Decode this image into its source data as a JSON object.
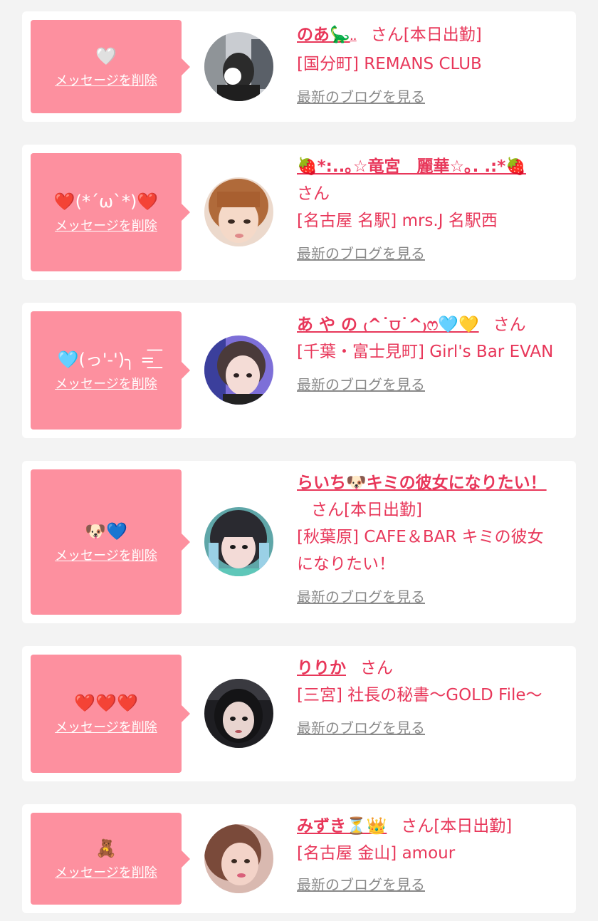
{
  "delete_label": "メッセージを削除",
  "blog_label": "最新のブログを見る",
  "colors": {
    "background": "#f3f3f3",
    "card": "#ffffff",
    "message_box": "#fd909f",
    "accent_text": "#e8375a",
    "link_gray": "#8a8a8a"
  },
  "favorites": [
    {
      "message": "🤍",
      "name": "のあ🦕",
      "name_suffix": "..",
      "suffix": "さん[本日出勤]",
      "shop": "[国分町] REMANS CLUB",
      "avatar_icon": "girl-photo-avatar-icon"
    },
    {
      "message": "❤️(*´ω`*)❤️",
      "name": "🍓*:..｡☆竜宮　麗華☆｡. .:*🍓",
      "name_suffix": "",
      "suffix": "さん",
      "shop": "[名古屋 名駅] mrs.J 名駅西",
      "avatar_icon": "girl-photo-avatar-icon"
    },
    {
      "message": "🩵(っ'-')╮ =͟͟͞͞",
      "name": "あ や の ₍^˙⩌˙^₎ෆ🩵💛",
      "name_suffix": "",
      "suffix": "さん",
      "shop": "[千葉・富士見町] Girl's Bar EVAN",
      "avatar_icon": "girl-photo-avatar-icon"
    },
    {
      "message": "🐶💙",
      "name": "らいち🐶キミの彼女になりたい！",
      "name_suffix": "",
      "suffix": "さん[本日出勤]",
      "shop": "[秋葉原] CAFE＆BAR キミの彼女になりたい！",
      "avatar_icon": "girl-photo-avatar-icon"
    },
    {
      "message": "❤️❤️❤️",
      "name": "りりか",
      "name_suffix": "",
      "suffix": "さん",
      "shop": "[三宮] 社長の秘書〜GOLD File〜",
      "avatar_icon": "girl-photo-avatar-icon"
    },
    {
      "message": "🧸",
      "name": "みずき⏳👑",
      "name_suffix": "",
      "suffix": "さん[本日出勤]",
      "shop": "[名古屋 金山] amour",
      "avatar_icon": "girl-photo-avatar-icon"
    }
  ]
}
